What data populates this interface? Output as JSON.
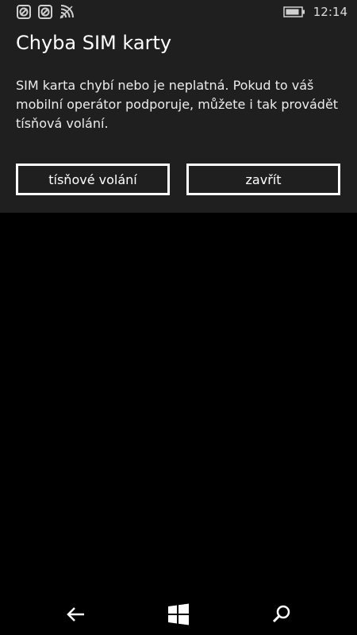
{
  "status_bar": {
    "time": "12:14",
    "icons": [
      "no-sim-icon",
      "no-sim-icon",
      "wifi-icon",
      "battery-icon"
    ]
  },
  "dialog": {
    "title": "Chyba SIM karty",
    "message": "SIM karta chybí nebo je neplatná. Pokud to váš mobilní operátor podporuje, můžete i tak provádět tísňová volání.",
    "emergency_label": "tísňové volání",
    "close_label": "zavřít"
  },
  "nav_bar": {
    "icons": [
      "back-arrow-icon",
      "windows-logo-icon",
      "search-icon"
    ]
  },
  "colors": {
    "panel": "#1f1f1f",
    "background": "#000000",
    "text": "#ffffff"
  }
}
